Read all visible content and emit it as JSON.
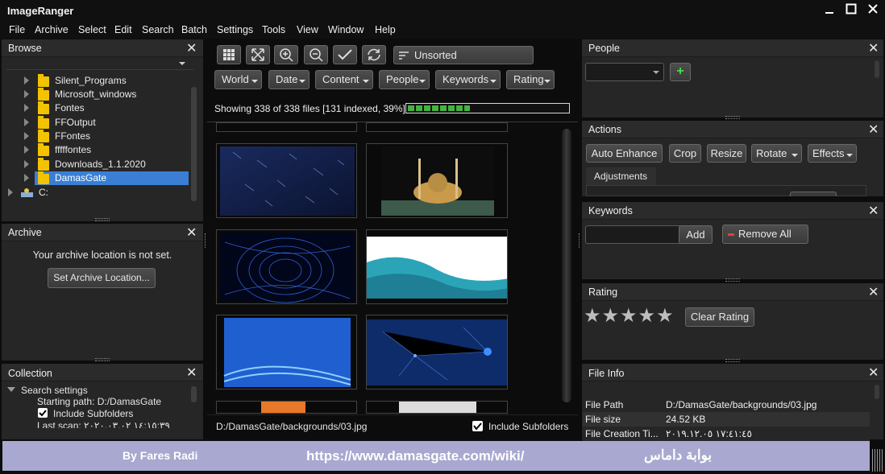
{
  "app": {
    "title": "ImageRanger"
  },
  "menu": [
    "File",
    "Archive",
    "Select",
    "Edit",
    "Search",
    "Batch",
    "Settings",
    "Tools",
    "View",
    "Window",
    "Help"
  ],
  "browse": {
    "title": "Browse",
    "folders": [
      "Silent_Programs",
      "Microsoft_windows",
      "Fontes",
      "FFOutput",
      "FFontes",
      "fffffontes",
      "Downloads_1.1.2020",
      "DamasGate"
    ],
    "selected": "DamasGate",
    "drive": "C:"
  },
  "archive": {
    "title": "Archive",
    "message": "Your archive location is not set.",
    "button": "Set Archive Location..."
  },
  "collection": {
    "title": "Collection",
    "group": "Search settings",
    "starting_path": "Starting path: D:/DamasGate",
    "include_subfolders": "Include Subfolders",
    "last_scan": "Last scan: ١٤:١٥:٣٩ ٢٠٢٠.٠٣.٠٢"
  },
  "toolbar": {
    "sort_label": "Unsorted"
  },
  "filters": [
    "World",
    "Date",
    "Content",
    "People",
    "Keywords",
    "Rating"
  ],
  "status": {
    "text": "Showing 338 of 338 files [131 indexed, 39%]",
    "progress": 0.39
  },
  "footer": {
    "path": "D:/DamasGate/backgrounds/03.jpg",
    "include_subfolders": "Include Subfolders"
  },
  "people": {
    "title": "People",
    "add_icon": "+"
  },
  "actions": {
    "title": "Actions",
    "buttons": [
      "Auto Enhance",
      "Crop",
      "Resize",
      "Rotate",
      "Effects"
    ],
    "tab": "Adjustments"
  },
  "keywords": {
    "title": "Keywords",
    "add": "Add",
    "remove_all": "Remove All"
  },
  "rating": {
    "title": "Rating",
    "value": 0,
    "max": 5,
    "clear": "Clear Rating"
  },
  "fileinfo": {
    "title": "File Info",
    "rows": [
      {
        "label": "File Path",
        "value": "D:/DamasGate/backgrounds/03.jpg"
      },
      {
        "label": "File size",
        "value": "24.52 KB"
      },
      {
        "label": "File Creation Ti...",
        "value": "١٧:٤١:٤٥ ٢٠١٩.١٢.٠٥"
      }
    ]
  },
  "watermark": {
    "author": "By Fares Radi",
    "url": "https://www.damasgate.com/wiki/",
    "arabic": "بوابة داماس"
  },
  "colors": {
    "accent": "#3a7fd5",
    "progress": "#41b53c",
    "watermark_bg": "#a8a8d0"
  }
}
